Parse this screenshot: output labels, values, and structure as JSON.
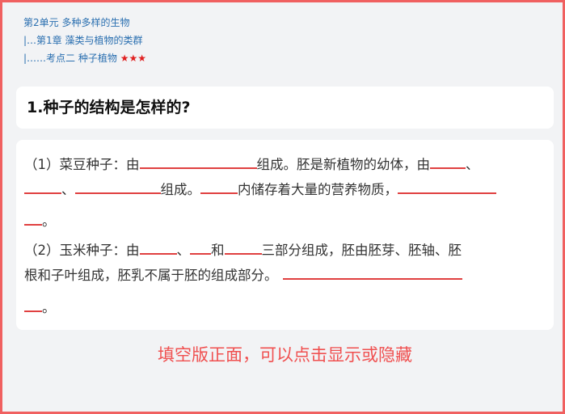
{
  "breadcrumb": {
    "level1": "第2单元 多种多样的生物",
    "level2": "|…第1章 藻类与植物的类群",
    "level3_text": "|……考点二 种子植物 ",
    "level3_stars": "★★★"
  },
  "question": {
    "title": "1.种子的结构是怎样的?"
  },
  "content": {
    "line1": {
      "a": "（1）菜豆种子：由",
      "b": "组成。胚是新植物的幼体，由",
      "c": "、"
    },
    "line2": {
      "a": "、",
      "b": "组成。",
      "c": "内储存着大量的营养物质，"
    },
    "line3": {
      "a": "。"
    },
    "line4": {
      "a": "（2）玉米种子：由",
      "b": "、",
      "c": "和",
      "d": "三部分组成，胚由胚芽、胚轴、胚"
    },
    "line5": {
      "a": "根和子叶组成，胚乳不属于胚的组成部分。"
    },
    "line6": {
      "a": "。"
    }
  },
  "footer": {
    "note": "填空版正面，可以点击显示或隐藏"
  },
  "colors": {
    "border": "#f06060",
    "blank_line": "#e04040",
    "breadcrumb": "#2a6fb0",
    "stars": "#e02020",
    "footer": "#f05050"
  }
}
